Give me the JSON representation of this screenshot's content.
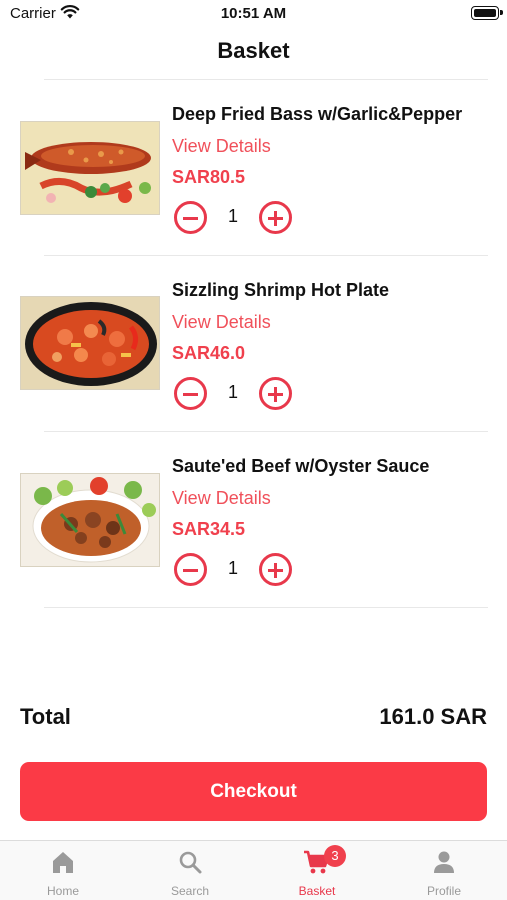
{
  "status_bar": {
    "carrier": "Carrier",
    "time": "10:51 AM"
  },
  "header": {
    "title": "Basket"
  },
  "items": [
    {
      "name": "Deep Fried Bass w/Garlic&Pepper",
      "details_label": "View Details",
      "price": "SAR80.5",
      "quantity": "1"
    },
    {
      "name": "Sizzling Shrimp Hot Plate",
      "details_label": "View Details",
      "price": "SAR46.0",
      "quantity": "1"
    },
    {
      "name": "Saute'ed Beef w/Oyster Sauce",
      "details_label": "View Details",
      "price": "SAR34.5",
      "quantity": "1"
    }
  ],
  "summary": {
    "total_label": "Total",
    "total_value": "161.0 SAR"
  },
  "checkout": {
    "label": "Checkout"
  },
  "tabbar": {
    "tabs": [
      {
        "label": "Home",
        "icon": "home-icon"
      },
      {
        "label": "Search",
        "icon": "search-icon"
      },
      {
        "label": "Basket",
        "icon": "cart-icon",
        "badge": "3",
        "active": true
      },
      {
        "label": "Profile",
        "icon": "person-icon"
      }
    ]
  },
  "colors": {
    "accent": "#fb3a46",
    "price": "#f0404d",
    "link": "#f0505a",
    "inactive_tab": "#9a9a9a"
  }
}
